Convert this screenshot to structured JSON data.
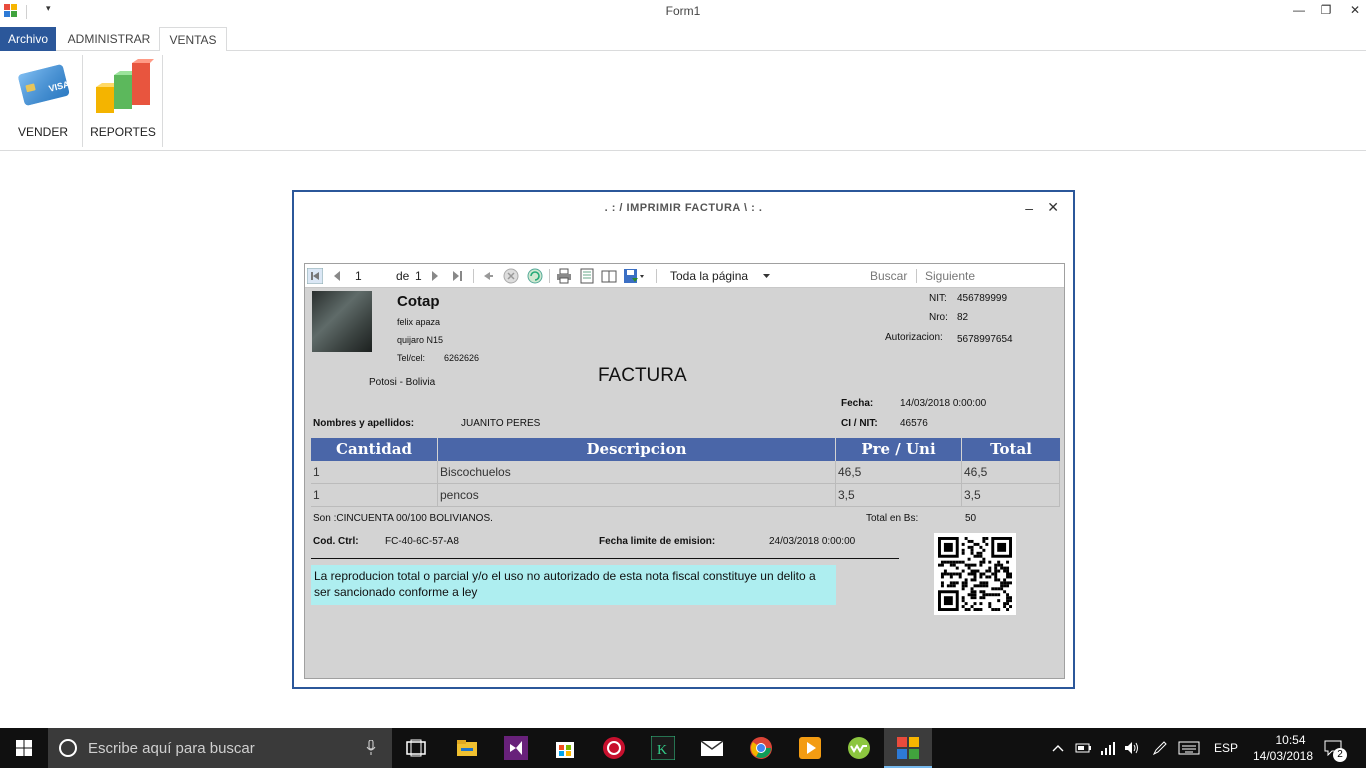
{
  "window": {
    "title": "Form1",
    "minimize_glyph": "—",
    "restore_glyph": "❐",
    "close_glyph": "✕",
    "qat_glyph": "▾"
  },
  "ribbon": {
    "tabs": [
      {
        "label": "Archivo"
      },
      {
        "label": "ADMINISTRAR"
      },
      {
        "label": "VENTAS"
      }
    ],
    "buttons": [
      {
        "label": "VENDER",
        "icon": "credit-card-icon"
      },
      {
        "label": "REPORTES",
        "icon": "bar-chart-icon"
      }
    ]
  },
  "dialog": {
    "title": ". : / IMPRIMIR FACTURA \\ : .",
    "minimize_glyph": "–",
    "close_glyph": "✕",
    "toolbar": {
      "page_current": "1",
      "page_of_label": "de",
      "page_total": "1",
      "zoom": "Toda la página",
      "find_label": "Buscar",
      "next_label": "Siguiente"
    }
  },
  "invoice": {
    "company": "Cotap",
    "owner": "felix apaza",
    "address": "quijaro N15",
    "phone_label": "Tel/cel:",
    "phone": "6262626",
    "location": "Potosi - Bolivia",
    "heading": "FACTURA",
    "nit_label": "NIT:",
    "nit": "456789999",
    "nro_label": "Nro:",
    "nro": "82",
    "auth_label": "Autorizacion:",
    "auth": "5678997654",
    "fecha_label": "Fecha:",
    "fecha": "14/03/2018 0:00:00",
    "client_label": "Nombres y apellidos:",
    "client": "JUANITO PERES",
    "ci_label": "CI / NIT:",
    "ci": "46576",
    "table": {
      "headers": [
        "Cantidad",
        "Descripcion",
        "Pre / Uni",
        "Total"
      ],
      "rows": [
        [
          "1",
          "Biscochuelos",
          "46,5",
          "46,5"
        ],
        [
          "1",
          "pencos",
          "3,5",
          "3,5"
        ]
      ]
    },
    "son": "Son :CINCUENTA 00/100 BOLIVIANOS.",
    "total_label": "Total en Bs:",
    "total": "50",
    "cod_label": "Cod. Ctrl:",
    "cod": "FC-40-6C-57-A8",
    "limit_label": "Fecha limite de emision:",
    "limit": "24/03/2018 0:00:00",
    "legal": "La reproducion total o parcial y/o el uso no autorizado de esta nota fiscal constituye un delito a ser sancionado conforme a ley"
  },
  "taskbar": {
    "search_placeholder": "Escribe aquí para buscar",
    "language": "ESP",
    "time": "10:54",
    "date": "14/03/2018",
    "notification_count": "2"
  },
  "colors": {
    "accent": "#2b579a",
    "table_header": "#4a66a8",
    "legal_bg": "#aeeef0",
    "report_bg": "#d3d3d3"
  }
}
